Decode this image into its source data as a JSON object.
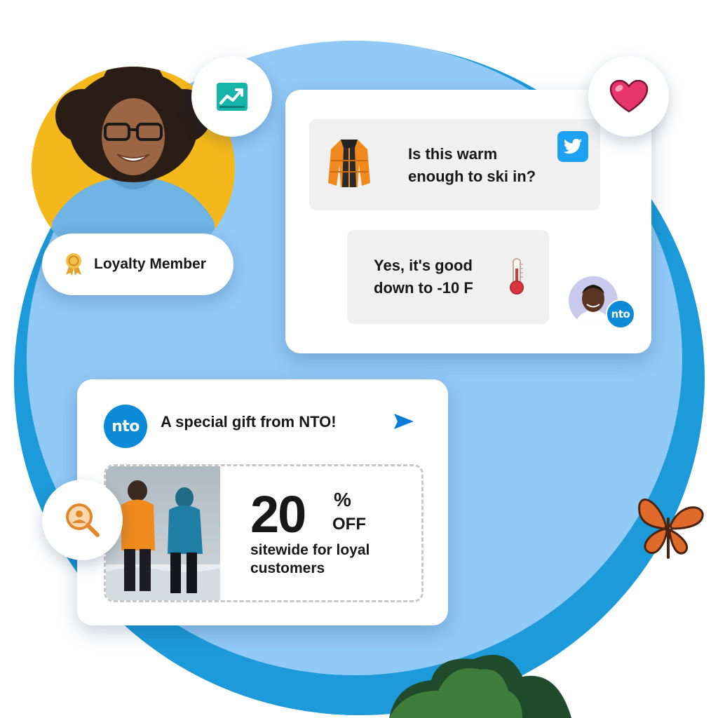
{
  "profile": {
    "badge_label": "Loyalty Member"
  },
  "chat": {
    "customer_message": {
      "line1": "Is this warm",
      "line2": "enough to ski in?",
      "channel": "twitter-icon"
    },
    "agent_reply": {
      "line1": "Yes, it's good",
      "line2": "down to -10 F",
      "icon": "thermometer-icon"
    },
    "agent_badge": "nto"
  },
  "gift": {
    "brand_badge": "nto",
    "title": "A special gift from NTO!",
    "discount_number": "20",
    "discount_percent": "%",
    "discount_off": "OFF",
    "description": "sitewide for loyal customers"
  },
  "icons": {
    "analytics": "trend-chart-icon",
    "favorite": "heart-icon",
    "search": "search-person-icon",
    "send": "send-icon",
    "award": "award-ribbon-icon"
  },
  "colors": {
    "ring": "#1d9ad9",
    "inner": "#91c9f7",
    "brand_blue": "#0b8ad8",
    "accent_yellow": "#f5b81a",
    "heart": "#e8356d",
    "teal": "#16b5a9",
    "orange": "#e2882b"
  }
}
